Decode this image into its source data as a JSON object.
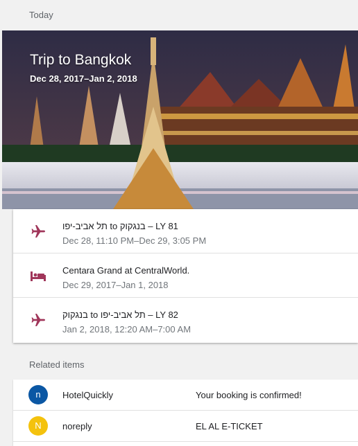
{
  "today_header": "Today",
  "trip": {
    "title": "Trip to Bangkok",
    "dates": "Dec 28, 2017–Jan 2, 2018"
  },
  "items": [
    {
      "icon": "airplane-icon",
      "title": "תל אביב-יפו to בנגקוק – LY 81",
      "subtitle": "Dec 28, 11:10 PM–Dec 29, 3:05 PM"
    },
    {
      "icon": "hotel-bed-icon",
      "title": "Centara Grand at CentralWorld.",
      "subtitle": "Dec 29, 2017–Jan 1, 2018"
    },
    {
      "icon": "airplane-icon",
      "title": "בנגקוק to תל אביב-יפו – LY 82",
      "subtitle": "Jan 2, 2018, 12:20 AM–7:00 AM"
    }
  ],
  "related_header": "Related items",
  "related": [
    {
      "avatar": "n",
      "avatar_color": "#0b57a4",
      "sender": "HotelQuickly",
      "subject": "Your booking is confirmed!"
    },
    {
      "avatar": "N",
      "avatar_color": "#f4c20d",
      "sender": "noreply",
      "subject": "EL AL E-TICKET"
    }
  ],
  "colors": {
    "icon": "#a0365a"
  }
}
